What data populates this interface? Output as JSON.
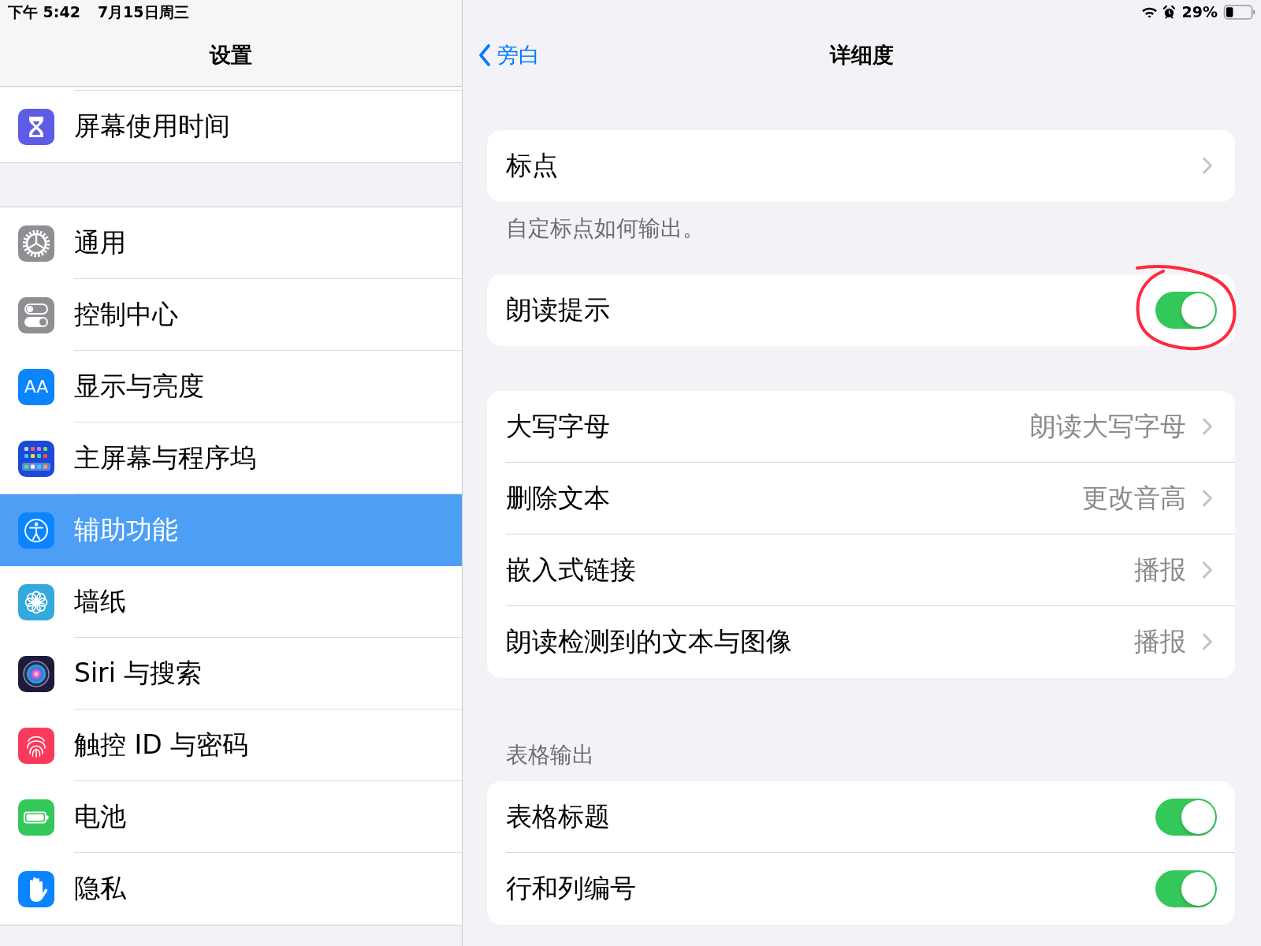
{
  "status_bar": {
    "time": "下午 5:42",
    "date": "7月15日周三",
    "battery_text": "29%"
  },
  "sidebar": {
    "title": "设置",
    "groups": [
      {
        "items": [
          {
            "label": "屏幕使用时间",
            "selected": false
          }
        ]
      },
      {
        "items": [
          {
            "label": "通用",
            "selected": false
          },
          {
            "label": "控制中心",
            "selected": false
          },
          {
            "label": "显示与亮度",
            "icon_text": "AA",
            "selected": false
          },
          {
            "label": "主屏幕与程序坞",
            "selected": false
          },
          {
            "label": "辅助功能",
            "selected": true
          },
          {
            "label": "墙纸",
            "selected": false
          },
          {
            "label": "Siri 与搜索",
            "selected": false
          },
          {
            "label": "触控 ID 与密码",
            "selected": false
          },
          {
            "label": "电池",
            "selected": false
          },
          {
            "label": "隐私",
            "selected": false
          }
        ]
      }
    ]
  },
  "detail": {
    "back": "旁白",
    "title": "详细度",
    "sections": [
      {
        "rows": [
          {
            "kind": "link",
            "label": "标点"
          }
        ],
        "footer": "自定标点如何输出。"
      },
      {
        "rows": [
          {
            "kind": "toggle",
            "label": "朗读提示",
            "on": true,
            "circled": true
          }
        ]
      },
      {
        "rows": [
          {
            "kind": "link",
            "label": "大写字母",
            "value": "朗读大写字母"
          },
          {
            "kind": "link",
            "label": "删除文本",
            "value": "更改音高"
          },
          {
            "kind": "link",
            "label": "嵌入式链接",
            "value": "播报"
          },
          {
            "kind": "link",
            "label": "朗读检测到的文本与图像",
            "value": "播报"
          }
        ]
      },
      {
        "header": "表格输出",
        "rows": [
          {
            "kind": "toggle",
            "label": "表格标题",
            "on": true,
            "circled": false
          },
          {
            "kind": "toggle",
            "label": "行和列编号",
            "on": true,
            "circled": false
          }
        ]
      }
    ]
  }
}
